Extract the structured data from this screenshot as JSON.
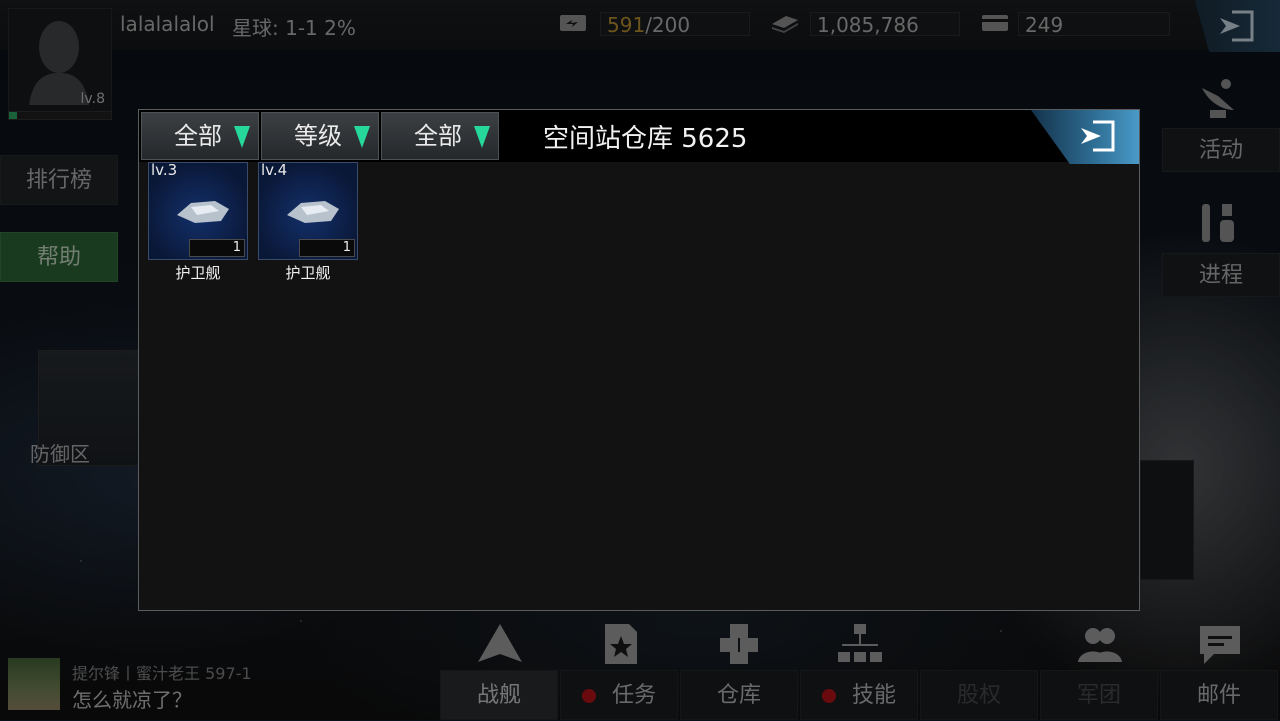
{
  "player": {
    "name": "lalalalalol",
    "planet": "星球: 1-1  2%",
    "level": "lv.8"
  },
  "resources": {
    "energy_current": "591",
    "energy_max": "/200",
    "credits": "1,085,786",
    "cards": "249"
  },
  "left_menu": {
    "rank": "排行榜",
    "help": "帮助",
    "defense": "防御区"
  },
  "right_menu": {
    "activity": "活动",
    "progress": "进程"
  },
  "chat": {
    "sender": "提尔锋丨蜜汁老王 597-1",
    "message": "怎么就凉了？"
  },
  "bottom_nav": [
    {
      "label": "战舰",
      "icon": "ship-icon",
      "dot": false,
      "state": "active"
    },
    {
      "label": "任务",
      "icon": "mission-icon",
      "dot": true,
      "state": "normal"
    },
    {
      "label": "仓库",
      "icon": "warehouse-icon",
      "dot": false,
      "state": "normal"
    },
    {
      "label": "技能",
      "icon": "skill-tree-icon",
      "dot": true,
      "state": "normal"
    },
    {
      "label": "股权",
      "icon": "",
      "dot": false,
      "state": "disabled"
    },
    {
      "label": "军团",
      "icon": "legion-icon",
      "dot": false,
      "state": "disabled"
    },
    {
      "label": "邮件",
      "icon": "mail-icon",
      "dot": false,
      "state": "normal"
    }
  ],
  "modal": {
    "filters": [
      "全部",
      "等级",
      "全部"
    ],
    "title": "空间站仓库 5625",
    "items": [
      {
        "level": "lv.3",
        "count": "1",
        "name": "护卫舰"
      },
      {
        "level": "lv.4",
        "count": "1",
        "name": "护卫舰"
      }
    ]
  },
  "colors": {
    "accent_green": "#27d89b",
    "energy_warning": "#c79a36",
    "notify_red": "#c0151a",
    "help_green": "#2f6b38"
  }
}
